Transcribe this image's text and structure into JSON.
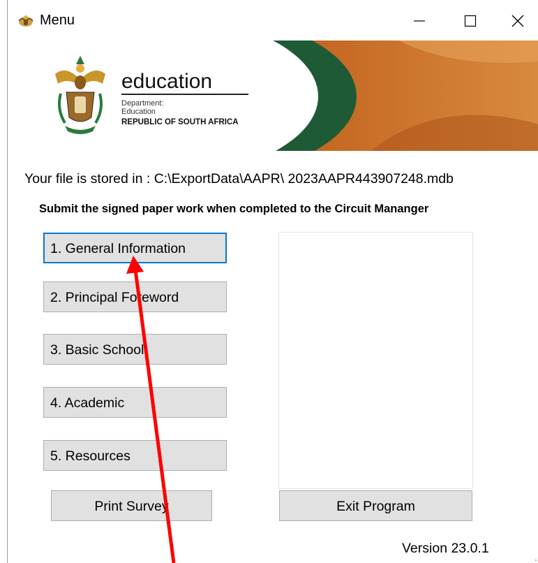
{
  "window": {
    "title": "Menu",
    "icon": "coat-of-arms-icon",
    "controls": {
      "minimize": "minimize-icon",
      "maximize": "maximize-icon",
      "close": "close-icon"
    }
  },
  "banner": {
    "title": "education",
    "dept_line1": "Department:",
    "dept_line2": "Education",
    "country": "REPUBLIC OF SOUTH AFRICA",
    "colors": {
      "green": "#1f5a36",
      "orange": "#c8681f",
      "cream": "#f4f0e6"
    }
  },
  "file_path_label": "Your file is stored in : C:\\ExportData\\AAPR\\ 2023AAPR443907248.mdb",
  "notice": "Submit the signed paper work when completed to the Circuit Mananger",
  "menu_buttons": [
    {
      "label": "1. General Information",
      "focused": true
    },
    {
      "label": "2. Principal Foreword"
    },
    {
      "label": "3. Basic School"
    },
    {
      "label": "4. Academic"
    },
    {
      "label": "5. Resources"
    }
  ],
  "print_button": "Print Survey",
  "exit_button": "Exit Program",
  "version": "Version 23.0.1",
  "annotation": {
    "color": "#ff0000"
  }
}
